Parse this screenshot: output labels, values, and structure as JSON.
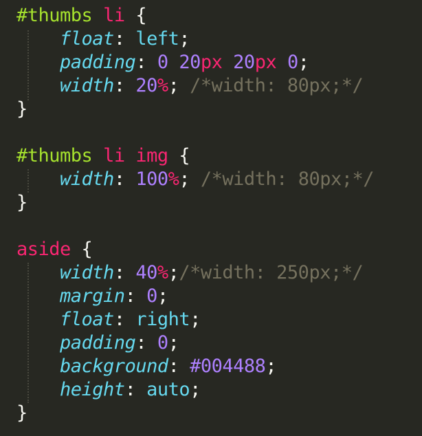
{
  "colors": {
    "background": "#272822",
    "id_selector": "#A6E22E",
    "tag_selector": "#F92672",
    "property": "#66D9EF",
    "number": "#AE81FF",
    "unit": "#F92672",
    "comment": "#75715E",
    "punctuation": "#F8F8F2"
  },
  "rules": [
    {
      "selector_id": "#thumbs",
      "selector_tag": "li",
      "open": "{",
      "close": "}",
      "decls": [
        {
          "prop": "float",
          "value": "left"
        },
        {
          "prop": "padding",
          "n1": "0",
          "n2": "20",
          "u2": "px",
          "n3": "20",
          "u3": "px",
          "n4": "0"
        },
        {
          "prop": "width",
          "num": "20",
          "unit": "%",
          "comment": "/*width: 80px;*/"
        }
      ]
    },
    {
      "selector_id": "#thumbs",
      "selector_tag1": "li",
      "selector_tag2": "img",
      "open": "{",
      "close": "}",
      "decls": [
        {
          "prop": "width",
          "num": "100",
          "unit": "%",
          "comment": "/*width: 80px;*/"
        }
      ]
    },
    {
      "selector_tag": "aside",
      "open": "{",
      "close": "}",
      "decls": [
        {
          "prop": "width",
          "num": "40",
          "unit": "%",
          "comment": "/*width: 250px;*/"
        },
        {
          "prop": "margin",
          "num": "0"
        },
        {
          "prop": "float",
          "value": "right"
        },
        {
          "prop": "padding",
          "num": "0"
        },
        {
          "prop": "background",
          "num": "#004488"
        },
        {
          "prop": "height",
          "value": "auto"
        }
      ]
    }
  ]
}
